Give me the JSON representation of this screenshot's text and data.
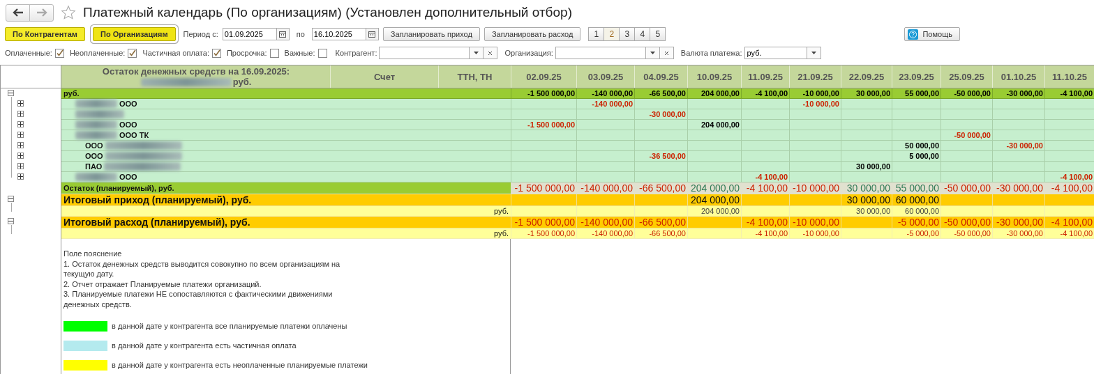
{
  "window": {
    "title": "Платежный календарь (По организациям) (Установлен дополнительный отбор)",
    "favorite": false
  },
  "modes": [
    {
      "label": "По Контрагентам",
      "selected": false
    },
    {
      "label": "По Организациям",
      "selected": true
    }
  ],
  "period": {
    "from_label": "Период с:",
    "from": "01.09.2025",
    "to_label": "по",
    "to": "16.10.2025"
  },
  "actions": [
    "Запланировать приход",
    "Запланировать расход"
  ],
  "pages": [
    {
      "label": "1",
      "selected": false
    },
    {
      "label": "2",
      "selected": true
    },
    {
      "label": "3",
      "selected": false
    },
    {
      "label": "4",
      "selected": false
    },
    {
      "label": "5",
      "selected": false
    }
  ],
  "help": "Помощь",
  "filters": [
    {
      "kind": "checkbox",
      "label": "Оплаченные:",
      "checked": true
    },
    {
      "kind": "checkbox",
      "label": "Неоплаченные:",
      "checked": true
    },
    {
      "kind": "checkbox",
      "label": "Частичная оплата:",
      "checked": true
    },
    {
      "kind": "checkbox",
      "label": "Просрочка:",
      "checked": false
    },
    {
      "kind": "checkbox",
      "label": "Важные:",
      "checked": false
    },
    {
      "kind": "combo",
      "label": "Контрагент:",
      "clearable": true
    },
    {
      "kind": "combo",
      "label": "Организация:",
      "clearable": true
    },
    {
      "kind": "combo",
      "label": "Валюта платежа:",
      "value": "руб.",
      "clearable": false
    }
  ],
  "table": {
    "header": {
      "balance_title": "Остаток денежных средств на 16.09.2025:",
      "balance_currency": "руб.",
      "columns": [
        "Счет",
        "ТТН, ТН"
      ],
      "dates": [
        "02.09.25",
        "03.09.25",
        "04.09.25",
        "10.09.25",
        "11.09.25",
        "21.09.25",
        "22.09.25",
        "23.09.25",
        "25.09.25",
        "01.10.25",
        "11.10.25"
      ]
    },
    "rows": [
      {
        "kind": "group",
        "label": "руб.",
        "expanded": true,
        "values": [
          {
            "t": "-1 500 000,00"
          },
          {
            "t": "-140 000,00"
          },
          {
            "t": "-66 500,00"
          },
          {
            "t": "204 000,00"
          },
          {
            "t": "-4 100,00"
          },
          {
            "t": "-10 000,00"
          },
          {
            "t": "30 000,00"
          },
          {
            "t": "55 000,00"
          },
          {
            "t": "-50 000,00"
          },
          {
            "t": "-30 000,00"
          },
          {
            "t": "-4 100,00"
          }
        ],
        "children": [
          {
            "kind": "org",
            "label": "ООО",
            "redacted_before": true,
            "redacted_after": false,
            "expanded": false,
            "values": [
              {
                "blank": true
              },
              {
                "t": "-140 000,00",
                "neg": true
              },
              {
                "blank": true
              },
              {
                "blank": true
              },
              {
                "blank": true
              },
              {
                "t": "-10 000,00",
                "neg": true
              },
              {
                "blank": true
              },
              {
                "blank": true
              },
              {
                "blank": true
              },
              {
                "blank": true
              },
              {
                "blank": true
              }
            ]
          },
          {
            "kind": "org",
            "redacted_before": true,
            "redacted_after": false,
            "expanded": false,
            "values": [
              {
                "blank": true
              },
              {
                "blank": true
              },
              {
                "t": "-30 000,00",
                "neg": true
              },
              {
                "blank": true
              },
              {
                "blank": true
              },
              {
                "blank": true
              },
              {
                "blank": true
              },
              {
                "blank": true
              },
              {
                "blank": true
              },
              {
                "blank": true
              },
              {
                "blank": true
              }
            ]
          },
          {
            "kind": "org",
            "label": "ООО",
            "redacted_before": true,
            "redacted_after": false,
            "expanded": false,
            "values": [
              {
                "t": "-1 500 000,00",
                "neg": true
              },
              {
                "blank": true
              },
              {
                "blank": true
              },
              {
                "t": "204 000,00",
                "neg": false
              },
              {
                "blank": true
              },
              {
                "blank": true
              },
              {
                "blank": true
              },
              {
                "blank": true
              },
              {
                "blank": true
              },
              {
                "blank": true
              },
              {
                "blank": true
              }
            ]
          },
          {
            "kind": "org",
            "label": "ООО ТК",
            "redacted_before": true,
            "redacted_after": false,
            "expanded": false,
            "values": [
              {
                "blank": true
              },
              {
                "blank": true
              },
              {
                "blank": true
              },
              {
                "blank": true
              },
              {
                "blank": true
              },
              {
                "blank": true
              },
              {
                "blank": true
              },
              {
                "blank": true
              },
              {
                "t": "-50 000,00",
                "neg": true
              },
              {
                "blank": true
              },
              {
                "blank": true
              }
            ]
          },
          {
            "kind": "org",
            "label": "ООО",
            "redacted_before": false,
            "redacted_after": true,
            "expanded": false,
            "values": [
              {
                "blank": true
              },
              {
                "blank": true
              },
              {
                "blank": true
              },
              {
                "blank": true
              },
              {
                "blank": true
              },
              {
                "blank": true
              },
              {
                "blank": true
              },
              {
                "t": "50 000,00",
                "neg": false
              },
              {
                "blank": true
              },
              {
                "t": "-30 000,00",
                "neg": true
              },
              {
                "blank": true
              }
            ]
          },
          {
            "kind": "org",
            "label": "ООО",
            "redacted_before": false,
            "redacted_after": true,
            "expanded": false,
            "values": [
              {
                "blank": true
              },
              {
                "blank": true
              },
              {
                "t": "-36 500,00",
                "neg": true
              },
              {
                "blank": true
              },
              {
                "blank": true
              },
              {
                "blank": true
              },
              {
                "blank": true
              },
              {
                "t": "5 000,00",
                "neg": false
              },
              {
                "blank": true
              },
              {
                "blank": true
              },
              {
                "blank": true
              }
            ]
          },
          {
            "kind": "org",
            "label": "ПАО",
            "redacted_before": false,
            "redacted_after": true,
            "expanded": false,
            "values": [
              {
                "blank": true
              },
              {
                "blank": true
              },
              {
                "blank": true
              },
              {
                "blank": true
              },
              {
                "blank": true
              },
              {
                "blank": true
              },
              {
                "t": "30 000,00",
                "neg": false
              },
              {
                "blank": true
              },
              {
                "blank": true
              },
              {
                "blank": true
              },
              {
                "blank": true
              }
            ]
          },
          {
            "kind": "org",
            "label": "ООО",
            "redacted_before": true,
            "redacted_after": false,
            "expanded": false,
            "values": [
              {
                "blank": true
              },
              {
                "blank": true
              },
              {
                "blank": true
              },
              {
                "blank": true
              },
              {
                "t": "-4 100,00",
                "neg": true
              },
              {
                "blank": true
              },
              {
                "blank": true
              },
              {
                "blank": true
              },
              {
                "blank": true
              },
              {
                "blank": true
              },
              {
                "t": "-4 100,00",
                "neg": true
              }
            ]
          }
        ]
      },
      {
        "kind": "balance",
        "label": "Остаток (планируемый), руб.",
        "values": [
          {
            "t": "-1 500 000,00",
            "neg": true
          },
          {
            "t": "-140 000,00",
            "neg": true
          },
          {
            "t": "-66 500,00",
            "neg": true
          },
          {
            "t": "204 000,00",
            "neg": false
          },
          {
            "t": "-4 100,00",
            "neg": true
          },
          {
            "t": "-10 000,00",
            "neg": true
          },
          {
            "t": "30 000,00",
            "neg": false
          },
          {
            "t": "55 000,00",
            "neg": false
          },
          {
            "t": "-50 000,00",
            "neg": true
          },
          {
            "t": "-30 000,00",
            "neg": true
          },
          {
            "t": "-4 100,00",
            "neg": true
          }
        ]
      },
      {
        "kind": "total",
        "label": "Итоговый приход (планируемый), руб.",
        "expanded": true,
        "values": [
          {
            "blank": true
          },
          {
            "blank": true
          },
          {
            "blank": true
          },
          {
            "t": "204 000,00",
            "neg": false
          },
          {
            "blank": true
          },
          {
            "blank": true
          },
          {
            "t": "30 000,00",
            "neg": false
          },
          {
            "t": "60 000,00",
            "neg": false
          },
          {
            "blank": true
          },
          {
            "blank": true
          },
          {
            "blank": true
          }
        ],
        "children": [
          {
            "kind": "currency",
            "label": "руб.",
            "values": [
              {
                "blank": true
              },
              {
                "blank": true
              },
              {
                "blank": true
              },
              {
                "t": "204 000,00",
                "neg": false
              },
              {
                "blank": true
              },
              {
                "blank": true
              },
              {
                "t": "30 000,00",
                "neg": false
              },
              {
                "t": "60 000,00",
                "neg": false
              },
              {
                "blank": true
              },
              {
                "blank": true
              },
              {
                "blank": true
              }
            ]
          }
        ]
      },
      {
        "kind": "total",
        "label": "Итоговый расход (планируемый), руб.",
        "expanded": true,
        "values": [
          {
            "t": "-1 500 000,00",
            "neg": true
          },
          {
            "t": "-140 000,00",
            "neg": true
          },
          {
            "t": "-66 500,00",
            "neg": true
          },
          {
            "blank": true
          },
          {
            "t": "-4 100,00",
            "neg": true
          },
          {
            "t": "-10 000,00",
            "neg": true
          },
          {
            "blank": true
          },
          {
            "t": "-5 000,00",
            "neg": true
          },
          {
            "t": "-50 000,00",
            "neg": true
          },
          {
            "t": "-30 000,00",
            "neg": true
          },
          {
            "t": "-4 100,00",
            "neg": true
          }
        ],
        "children": [
          {
            "kind": "currency",
            "label": "руб.",
            "values": [
              {
                "t": "-1 500 000,00",
                "neg": true
              },
              {
                "t": "-140 000,00",
                "neg": true
              },
              {
                "t": "-66 500,00",
                "neg": true
              },
              {
                "blank": true
              },
              {
                "t": "-4 100,00",
                "neg": true
              },
              {
                "t": "-10 000,00",
                "neg": true
              },
              {
                "blank": true
              },
              {
                "t": "-5 000,00",
                "neg": true
              },
              {
                "t": "-50 000,00",
                "neg": true
              },
              {
                "t": "-30 000,00",
                "neg": true
              },
              {
                "t": "-4 100,00",
                "neg": true
              }
            ]
          }
        ]
      }
    ]
  },
  "notes": {
    "lines": [
      "Поле пояснение",
      "1. Остаток денежных средств выводится совокупно по всем организациям на текущую дату.",
      "2.  Отчет отражает Планируемые платежи организаций.",
      "3.  Планируемые платежи НЕ сопоставляются с фактическими движениями денежных средств."
    ],
    "legend": [
      {
        "color": "#00ff00",
        "text": "в данной дате у контрагента все планируемые платежи оплачены"
      },
      {
        "color": "#b4eaee",
        "text": "в данной дате у контрагента есть частичная оплата"
      },
      {
        "color": "#ffff00",
        "text": "в данной дате у контрагента есть неоплаченные планируемые платежи"
      }
    ]
  }
}
